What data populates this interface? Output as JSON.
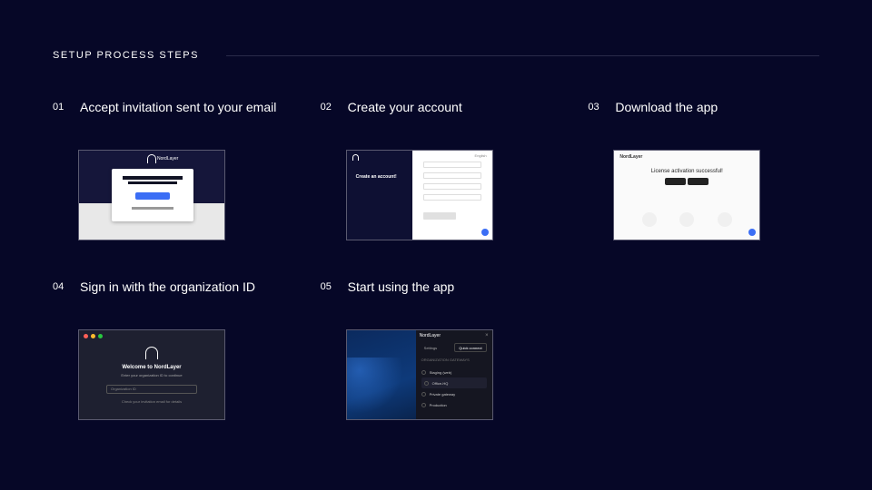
{
  "section_title": "SETUP PROCESS STEPS",
  "steps": [
    {
      "num": "01",
      "title": "Accept invitation sent to your email"
    },
    {
      "num": "02",
      "title": "Create your account"
    },
    {
      "num": "03",
      "title": "Download the app"
    },
    {
      "num": "04",
      "title": "Sign in with the organization ID"
    },
    {
      "num": "05",
      "title": "Start using the app"
    }
  ],
  "thumb1": {
    "brand": "NordLayer"
  },
  "thumb2": {
    "heading": "Create an account!",
    "brand": "NordLayer",
    "lang": "English"
  },
  "thumb3": {
    "brand": "NordLayer",
    "heading": "License activation successful!"
  },
  "thumb4": {
    "welcome": "Welcome to NordLayer",
    "subtitle": "Enter your organization ID to continue",
    "placeholder": "Organization ID",
    "helper": "Check your invitation email for details"
  },
  "thumb5": {
    "brand": "NordLayer",
    "tab_settings": "Settings",
    "tab_connect": "Quick connect",
    "section_label": "ORGANIZATION GATEWAYS",
    "rows": [
      "Staging (web)",
      "Office-HQ",
      "Private gateway",
      "Production"
    ]
  }
}
